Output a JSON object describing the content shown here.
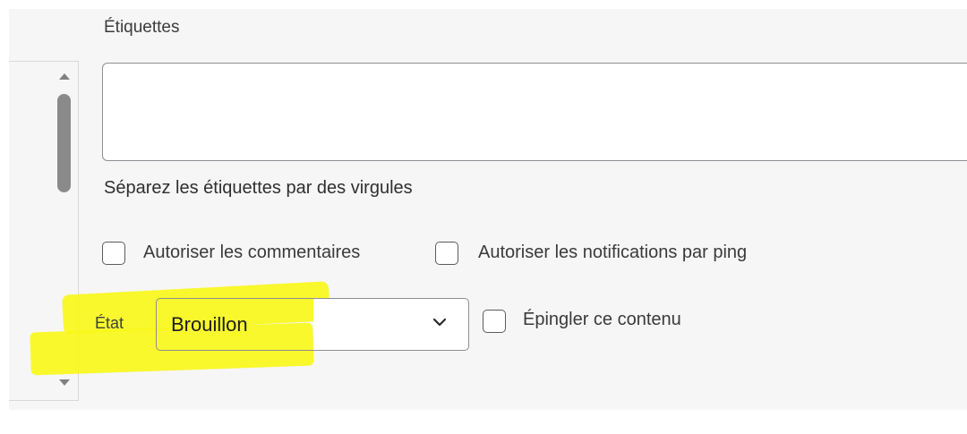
{
  "tags": {
    "label": "Étiquettes",
    "value": "",
    "hint": "Séparez les étiquettes par des virgules"
  },
  "options": {
    "allow_comments": {
      "label": "Autoriser les commentaires",
      "checked": false
    },
    "allow_pings": {
      "label": "Autoriser les notifications par ping",
      "checked": false
    }
  },
  "status": {
    "label": "État",
    "selected": "Brouillon"
  },
  "pin": {
    "label": "Épingler ce contenu",
    "checked": false
  },
  "colors": {
    "highlight": "#f7f71b",
    "panel_bg": "#f6f6f6",
    "border": "#8c8f94"
  },
  "icons": [
    "scroll-up-arrow-icon",
    "scroll-down-arrow-icon",
    "chevron-down-icon"
  ]
}
